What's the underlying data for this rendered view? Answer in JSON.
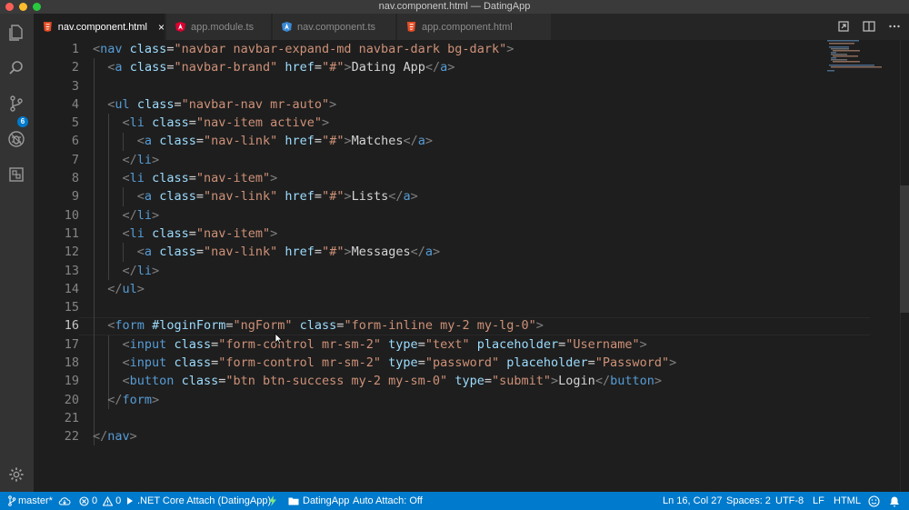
{
  "window": {
    "title": "nav.component.html — DatingApp"
  },
  "activity_bar": {
    "items": [
      "explorer-icon",
      "search-icon",
      "source-control-icon",
      "debug-icon",
      "extensions-icon"
    ],
    "scm_badge": "6",
    "manage": "gear-icon"
  },
  "tabs": [
    {
      "label": "nav.component.html",
      "icon": "html5-icon",
      "color": "#e44d26",
      "active": true,
      "close": "×"
    },
    {
      "label": "app.module.ts",
      "icon": "angular-icon",
      "color": "#dd0031"
    },
    {
      "label": "nav.component.ts",
      "icon": "angular-icon",
      "color": "#3a8ad6"
    },
    {
      "label": "app.component.html",
      "icon": "html5-icon",
      "color": "#e44d26"
    }
  ],
  "editor": {
    "line_numbers": [
      "1",
      "2",
      "3",
      "4",
      "5",
      "6",
      "7",
      "8",
      "9",
      "10",
      "11",
      "12",
      "13",
      "14",
      "15",
      "16",
      "17",
      "18",
      "19",
      "20",
      "21",
      "22"
    ],
    "current_line": 16
  },
  "status_bar": {
    "branch": "master*",
    "errors": "0",
    "warnings": "0",
    "debug": ".NET Core Attach (DatingApp)",
    "folder": "DatingApp",
    "auto_attach": "Auto Attach: Off",
    "position": "Ln 16, Col 27",
    "spaces": "Spaces: 2",
    "encoding": "UTF-8",
    "eol": "LF",
    "language": "HTML"
  },
  "colors": {
    "tag": "#569cd6",
    "attribute": "#9cdcfe",
    "string": "#ce9178",
    "bracket": "#808080",
    "text": "#d4d4d4",
    "status_bar": "#007acc"
  }
}
